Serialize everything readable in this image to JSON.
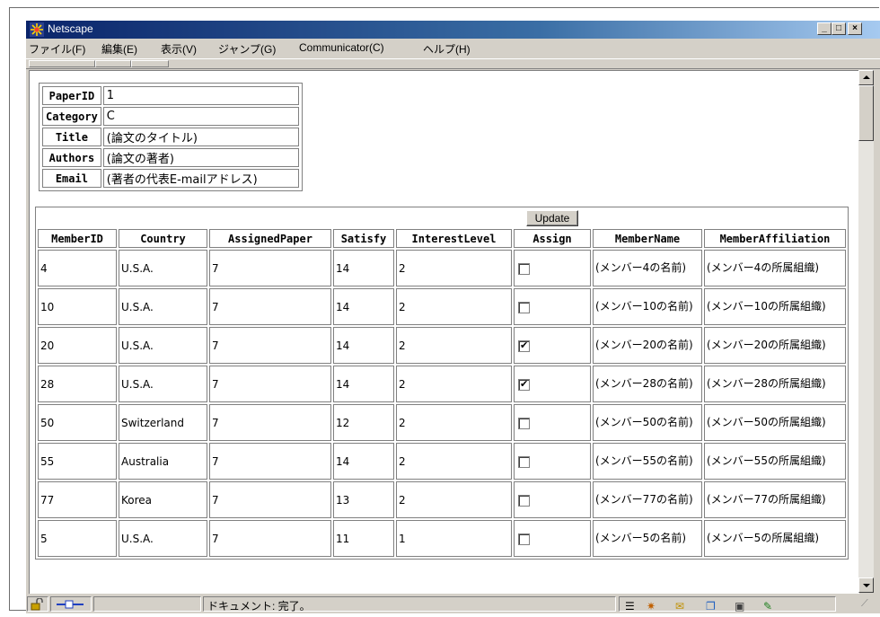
{
  "window": {
    "title": "Netscape",
    "buttons": [
      "_",
      "□",
      "×"
    ]
  },
  "menu": [
    "ファイル(F)",
    "編集(E)",
    "表示(V)",
    "ジャンプ(G)",
    "Communicator(C)",
    "ヘルプ(H)"
  ],
  "paper": {
    "rows": [
      {
        "label": "PaperID",
        "value": "1"
      },
      {
        "label": "Category",
        "value": "C"
      },
      {
        "label": "Title",
        "value": "(論文のタイトル)"
      },
      {
        "label": "Authors",
        "value": "(論文の著者)"
      },
      {
        "label": "Email",
        "value": "(著者の代表E-mailアドレス)"
      }
    ]
  },
  "update_label": "Update",
  "columns": [
    "MemberID",
    "Country",
    "AssignedPaper",
    "Satisfy",
    "InterestLevel",
    "Assign",
    "MemberName",
    "MemberAffiliation"
  ],
  "members": [
    {
      "id": "4",
      "country": "U.S.A.",
      "assigned": "7",
      "satisfy": "14",
      "interest": "2",
      "assign": false,
      "name": "(メンバー4の名前)",
      "aff": "(メンバー4の所属組織)"
    },
    {
      "id": "10",
      "country": "U.S.A.",
      "assigned": "7",
      "satisfy": "14",
      "interest": "2",
      "assign": false,
      "name": "(メンバー10の名前)",
      "aff": "(メンバー10の所属組織)"
    },
    {
      "id": "20",
      "country": "U.S.A.",
      "assigned": "7",
      "satisfy": "14",
      "interest": "2",
      "assign": true,
      "name": "(メンバー20の名前)",
      "aff": "(メンバー20の所属組織)"
    },
    {
      "id": "28",
      "country": "U.S.A.",
      "assigned": "7",
      "satisfy": "14",
      "interest": "2",
      "assign": true,
      "name": "(メンバー28の名前)",
      "aff": "(メンバー28の所属組織)"
    },
    {
      "id": "50",
      "country": "Switzerland",
      "assigned": "7",
      "satisfy": "12",
      "interest": "2",
      "assign": false,
      "name": "(メンバー50の名前)",
      "aff": "(メンバー50の所属組織)"
    },
    {
      "id": "55",
      "country": "Australia",
      "assigned": "7",
      "satisfy": "14",
      "interest": "2",
      "assign": false,
      "name": "(メンバー55の名前)",
      "aff": "(メンバー55の所属組織)"
    },
    {
      "id": "77",
      "country": "Korea",
      "assigned": "7",
      "satisfy": "13",
      "interest": "2",
      "assign": false,
      "name": "(メンバー77の名前)",
      "aff": "(メンバー77の所属組織)"
    },
    {
      "id": "5",
      "country": "U.S.A.",
      "assigned": "7",
      "satisfy": "11",
      "interest": "1",
      "assign": false,
      "name": "(メンバー5の名前)",
      "aff": "(メンバー5の所属組織)"
    }
  ],
  "status": {
    "text": "ドキュメント: 完了。"
  },
  "colors": {
    "titlebar": "#0a246a",
    "chrome": "#d4d0c8",
    "border": "#808080"
  }
}
